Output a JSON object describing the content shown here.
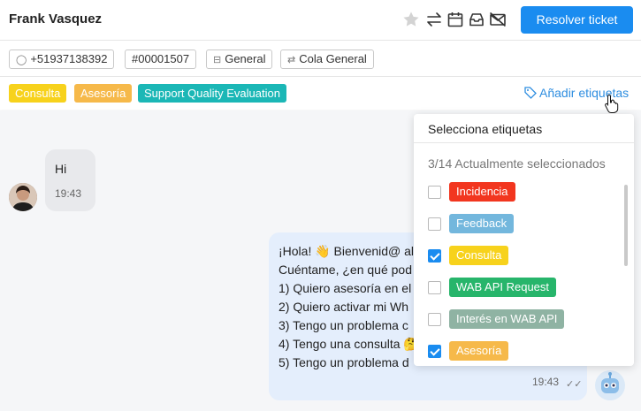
{
  "header": {
    "contact_name": "Frank Vasquez",
    "resolve_label": "Resolver ticket",
    "icons": [
      "star-icon",
      "transfer-icon",
      "calendar-icon",
      "archive-icon",
      "mail-off-icon"
    ]
  },
  "meta": {
    "phone": "+51937138392",
    "ticket_id": "#00001507",
    "inbox": "General",
    "queue": "Cola General"
  },
  "tags": {
    "applied": [
      {
        "label": "Consulta",
        "color": "#f7d21c"
      },
      {
        "label": "Asesoría",
        "color": "#f6b94a"
      },
      {
        "label": "Support Quality Evaluation",
        "color": "#1bb7b6"
      }
    ],
    "add_label": "Añadir etiquetas"
  },
  "chat": {
    "incoming": {
      "text": "Hi",
      "time": "19:43"
    },
    "outgoing": {
      "lines": [
        "¡Hola! 👋 Bienvenid@ al",
        "Cuéntame, ¿en qué pod",
        "1) Quiero asesoría en el",
        "2) Quiero activar mi Wh",
        "3) Tengo un problema c",
        "4) Tengo una consulta 🤔",
        "5) Tengo un problema d"
      ],
      "time": "19:43"
    }
  },
  "dropdown": {
    "title": "Selecciona etiquetas",
    "count": "3/14 Actualmente seleccionados",
    "items": [
      {
        "label": "Incidencia",
        "checked": false,
        "bg": "#f2361f",
        "fg": "#ffffff"
      },
      {
        "label": "Feedback",
        "checked": false,
        "bg": "#73b7dd",
        "fg": "#ffffff"
      },
      {
        "label": "Consulta",
        "checked": true,
        "bg": "#f7d21c",
        "fg": "#ffffff"
      },
      {
        "label": "WAB API Request",
        "checked": false,
        "bg": "#27b56b",
        "fg": "#ffffff"
      },
      {
        "label": "Interés en WAB API",
        "checked": false,
        "bg": "#8fb3a3",
        "fg": "#ffffff"
      },
      {
        "label": "Asesoría",
        "checked": true,
        "bg": "#f6b94a",
        "fg": "#ffffff"
      }
    ]
  }
}
